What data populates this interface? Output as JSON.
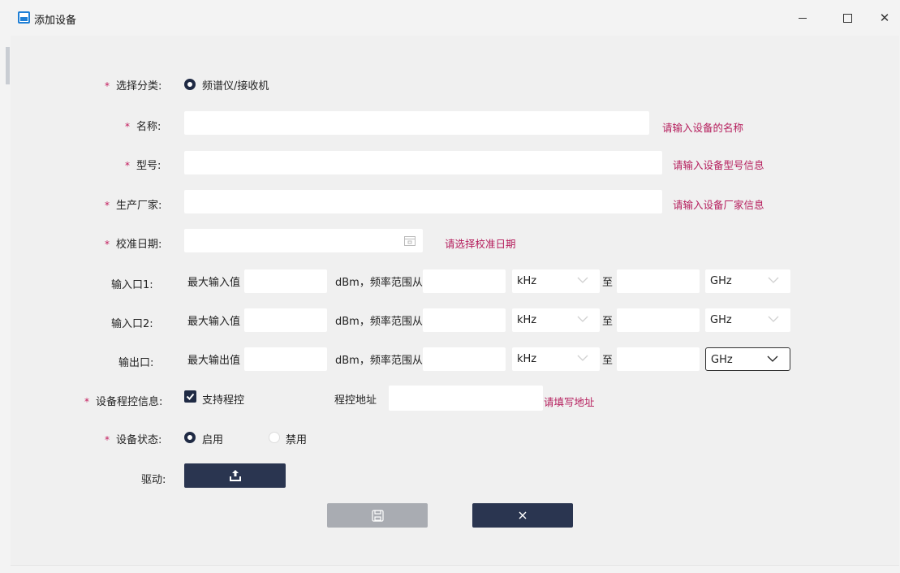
{
  "window": {
    "title": "添加设备",
    "minimize": "—",
    "maximize": "□",
    "close": "✕"
  },
  "form": {
    "category": {
      "label": "选择分类:",
      "option": "频谱仪/接收机"
    },
    "name": {
      "label": "名称:",
      "value": "",
      "hint": "请输入设备的名称"
    },
    "model": {
      "label": "型号:",
      "value": "",
      "hint": "请输入设备型号信息"
    },
    "manufacturer": {
      "label": "生产厂家:",
      "value": "",
      "hint": "请输入设备厂家信息"
    },
    "calibration_date": {
      "label": "校准日期:",
      "value": "",
      "hint": "请选择校准日期"
    },
    "ports": [
      {
        "label": "输入口1:",
        "max_label": "最大输入值",
        "dbm_label": "dBm，频率范围从",
        "from_unit": "kHz",
        "to_label": "至",
        "to_unit": "GHz"
      },
      {
        "label": "输入口2:",
        "max_label": "最大输入值",
        "dbm_label": "dBm，频率范围从",
        "from_unit": "kHz",
        "to_label": "至",
        "to_unit": "GHz"
      },
      {
        "label": "输出口:",
        "max_label": "最大输出值",
        "dbm_label": "dBm，频率范围从",
        "from_unit": "kHz",
        "to_label": "至",
        "to_unit": "GHz"
      }
    ],
    "program_control": {
      "label": "设备程控信息:",
      "checkbox_label": "支持程控",
      "address_label": "程控地址",
      "address_value": "",
      "hint": "请填写地址"
    },
    "status": {
      "label": "设备状态:",
      "options": [
        "启用",
        "禁用"
      ],
      "selected": "启用"
    },
    "driver": {
      "label": "驱动:"
    }
  },
  "colors": {
    "accent": "#2a3550",
    "hint": "#b51d5c",
    "disabled_button": "#a9acb2"
  },
  "icons": {
    "upload": "upload-icon",
    "save": "save-icon",
    "cancel": "close-icon",
    "calendar": "calendar-icon"
  }
}
